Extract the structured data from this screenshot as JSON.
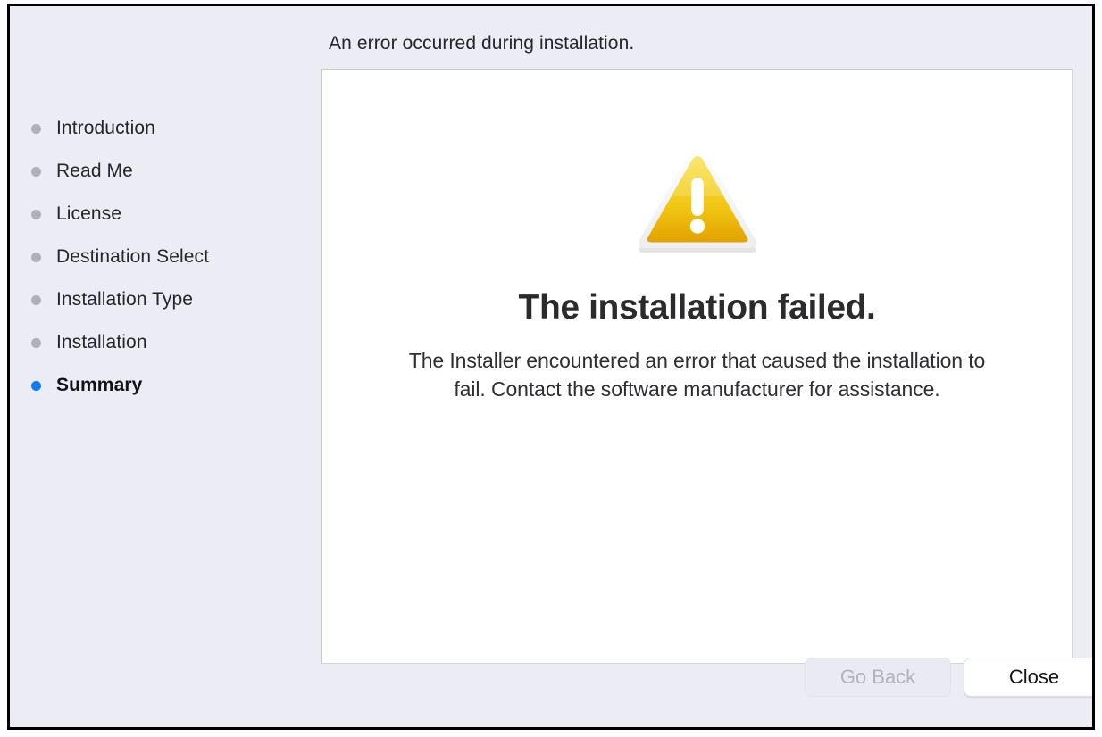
{
  "window": {
    "background_color": "#ececf5",
    "frame_color": "#000000"
  },
  "header": {
    "title": "An error occurred during installation."
  },
  "sidebar": {
    "active_dot_color": "#0a7cf7",
    "inactive_dot_color": "#b0b0b8",
    "items": [
      {
        "label": "Introduction",
        "active": false
      },
      {
        "label": "Read Me",
        "active": false
      },
      {
        "label": "License",
        "active": false
      },
      {
        "label": "Destination Select",
        "active": false
      },
      {
        "label": "Installation Type",
        "active": false
      },
      {
        "label": "Installation",
        "active": false
      },
      {
        "label": "Summary",
        "active": true
      }
    ]
  },
  "content": {
    "icon": "warning-triangle-icon",
    "icon_colors": {
      "top": "#f7dc3f",
      "bottom": "#e5a500",
      "border": "#f2f2f2",
      "mark": "#ffffff"
    },
    "heading": "The installation failed.",
    "body": "The Installer encountered an error that caused the installation to fail. Contact the software manufacturer for assistance."
  },
  "footer": {
    "go_back_label": "Go Back",
    "go_back_enabled": false,
    "close_label": "Close",
    "close_enabled": true
  }
}
